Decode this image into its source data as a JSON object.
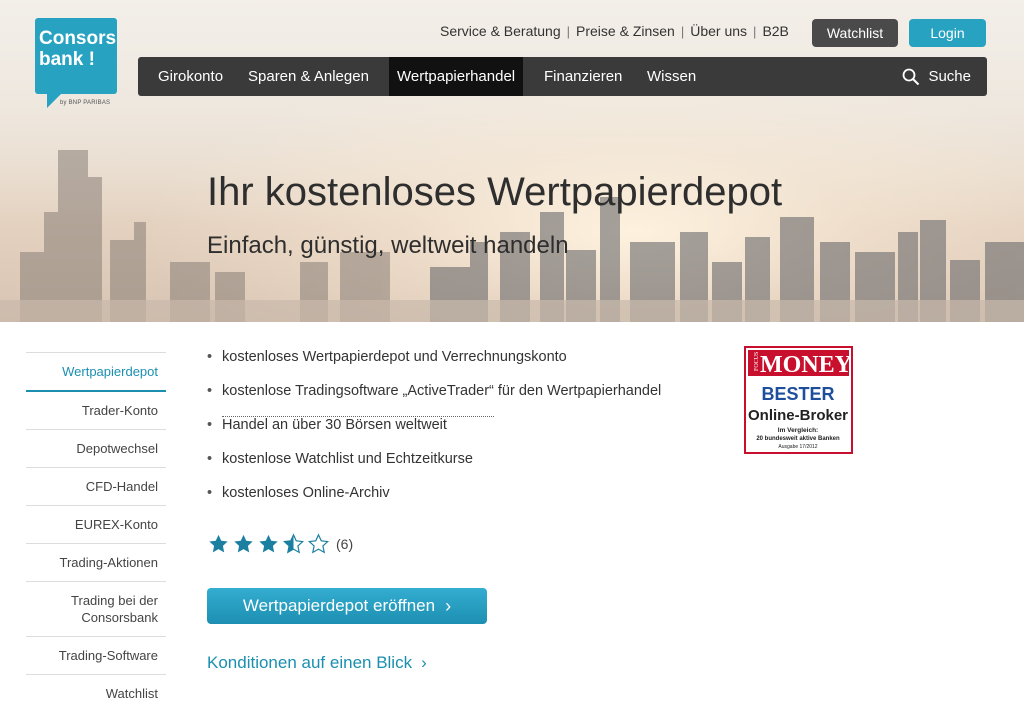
{
  "logo": {
    "line1": "Consors",
    "line2": "bank !",
    "sub": "by BNP PARIBAS"
  },
  "header": {
    "links": [
      "Service & Beratung",
      "Preise & Zinsen",
      "Über uns",
      "B2B"
    ],
    "watchlist_label": "Watchlist",
    "login_label": "Login"
  },
  "nav": {
    "items": [
      "Girokonto",
      "Sparen & Anlegen",
      "Wertpapierhandel",
      "Finanzieren",
      "Wissen"
    ],
    "active": "Wertpapierhandel",
    "search_label": "Suche"
  },
  "hero": {
    "title": "Ihr kostenloses Wertpapierdepot",
    "subtitle": "Einfach, günstig, weltweit handeln"
  },
  "sidebar": {
    "items": [
      "Wertpapierdepot",
      "Trader-Konto",
      "Depotwechsel",
      "CFD-Handel",
      "EUREX-Konto",
      "Trading-Aktionen",
      "Trading bei der Consorsbank",
      "Trading-Software",
      "Watchlist"
    ],
    "active": "Wertpapierdepot"
  },
  "features": [
    "kostenloses Wertpapierdepot und Verrechnungskonto",
    "kostenlose Tradingsoftware „ActiveTrader“",
    "für den Wertpapierhandel",
    "Handel an über 30 Börsen weltweit",
    "kostenlose Watchlist und Echtzeitkurse",
    "kostenloses Online-Archiv"
  ],
  "badge": {
    "brand_small": "FOCUS",
    "brand": "MONEY",
    "line1": "BESTER",
    "line2": "Online-Broker",
    "line3": "Im Vergleich:",
    "line4": "20 bundesweit aktive Banken",
    "line5": "Ausgabe 17/2012"
  },
  "rating": {
    "value": 3.5,
    "max": 5,
    "count": "(6)"
  },
  "cta": {
    "label": "Wertpapierdepot eröffnen",
    "chevron": "›"
  },
  "conditions_link": {
    "label": "Konditionen auf einen Blick",
    "chevron": "›"
  },
  "colors": {
    "accent": "#27a3c1",
    "nav_bg": "#3a3a3a",
    "link": "#1b8fb0",
    "badge_red": "#c8102e"
  }
}
